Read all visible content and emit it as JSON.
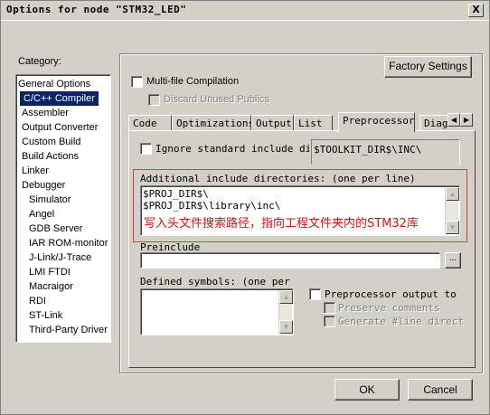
{
  "window": {
    "title": "Options for node \"STM32_LED\"",
    "close_glyph": "X"
  },
  "category": {
    "label": "Category:",
    "items": [
      "General Options",
      "C/C++ Compiler",
      "Assembler",
      "Output Converter",
      "Custom Build",
      "Build Actions",
      "Linker",
      "Debugger",
      "Simulator",
      "Angel",
      "GDB Server",
      "IAR ROM-monitor",
      "J-Link/J-Trace",
      "LMI FTDI",
      "Macraigor",
      "RDI",
      "ST-Link",
      "Third-Party Driver"
    ],
    "selected": "C/C++ Compiler"
  },
  "top": {
    "factory_settings": "Factory Settings",
    "multi_file": "Multi-file Compilation",
    "discard_unused": "Discard Unused Publics"
  },
  "tabs": [
    "Code",
    "Optimizations",
    "Output",
    "List",
    "Preprocessor",
    "Diagn"
  ],
  "active_tab": "Preprocessor",
  "preprocessor": {
    "ignore_std": "Ignore standard include dire",
    "toolkit_dir": "$TOOLKIT_DIR$\\INC\\",
    "additional_label": "Additional include directories: (one per line)",
    "include_lines": [
      "$PROJ_DIR$\\",
      "$PROJ_DIR$\\library\\inc\\"
    ],
    "annotation": "写入头文件搜索路径，指向工程文件夹内的STM32库",
    "preinclude_label": "Preinclude",
    "preinclude_value": "",
    "browse_label": "...",
    "defined_label": "Defined symbols: (one per",
    "pp_output": "Preprocessor output to",
    "preserve_comments": "Preserve comments",
    "generate_line": "Generate #line directiv"
  },
  "buttons": {
    "ok": "OK",
    "cancel": "Cancel"
  },
  "colors": {
    "face": "#d4d0c8",
    "selection": "#0a246a",
    "annotation_red": "#e01010",
    "highlight_box": "#d84040"
  }
}
